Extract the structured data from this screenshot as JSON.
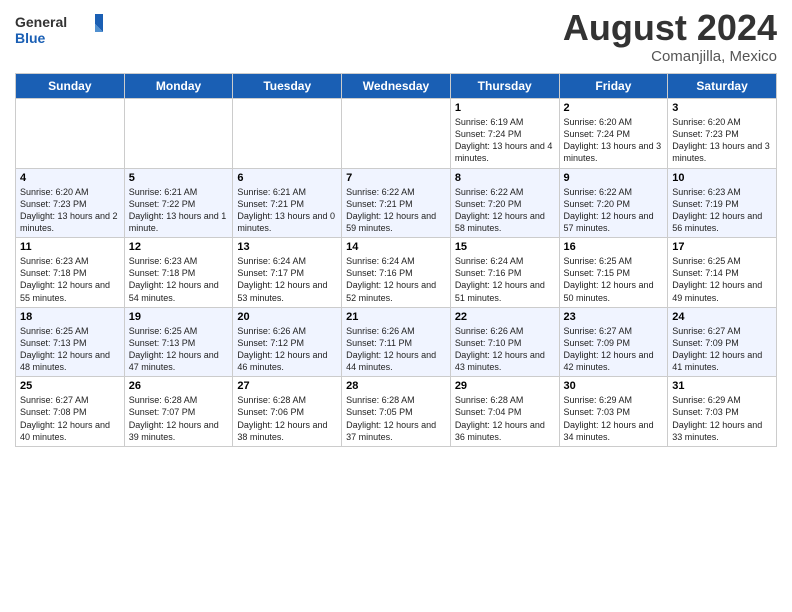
{
  "header": {
    "logo_general": "General",
    "logo_blue": "Blue",
    "month_title": "August 2024",
    "location": "Comanjilla, Mexico"
  },
  "days_of_week": [
    "Sunday",
    "Monday",
    "Tuesday",
    "Wednesday",
    "Thursday",
    "Friday",
    "Saturday"
  ],
  "weeks": [
    {
      "row_class": "row-white",
      "days": [
        {
          "num": "",
          "empty": true
        },
        {
          "num": "",
          "empty": true
        },
        {
          "num": "",
          "empty": true
        },
        {
          "num": "",
          "empty": true
        },
        {
          "num": "1",
          "sunrise": "6:19 AM",
          "sunset": "7:24 PM",
          "daylight": "13 hours and 4 minutes."
        },
        {
          "num": "2",
          "sunrise": "6:20 AM",
          "sunset": "7:24 PM",
          "daylight": "13 hours and 3 minutes."
        },
        {
          "num": "3",
          "sunrise": "6:20 AM",
          "sunset": "7:23 PM",
          "daylight": "13 hours and 3 minutes."
        }
      ]
    },
    {
      "row_class": "row-light",
      "days": [
        {
          "num": "4",
          "sunrise": "6:20 AM",
          "sunset": "7:23 PM",
          "daylight": "13 hours and 2 minutes."
        },
        {
          "num": "5",
          "sunrise": "6:21 AM",
          "sunset": "7:22 PM",
          "daylight": "13 hours and 1 minute."
        },
        {
          "num": "6",
          "sunrise": "6:21 AM",
          "sunset": "7:21 PM",
          "daylight": "13 hours and 0 minutes."
        },
        {
          "num": "7",
          "sunrise": "6:22 AM",
          "sunset": "7:21 PM",
          "daylight": "12 hours and 59 minutes."
        },
        {
          "num": "8",
          "sunrise": "6:22 AM",
          "sunset": "7:20 PM",
          "daylight": "12 hours and 58 minutes."
        },
        {
          "num": "9",
          "sunrise": "6:22 AM",
          "sunset": "7:20 PM",
          "daylight": "12 hours and 57 minutes."
        },
        {
          "num": "10",
          "sunrise": "6:23 AM",
          "sunset": "7:19 PM",
          "daylight": "12 hours and 56 minutes."
        }
      ]
    },
    {
      "row_class": "row-white",
      "days": [
        {
          "num": "11",
          "sunrise": "6:23 AM",
          "sunset": "7:18 PM",
          "daylight": "12 hours and 55 minutes."
        },
        {
          "num": "12",
          "sunrise": "6:23 AM",
          "sunset": "7:18 PM",
          "daylight": "12 hours and 54 minutes."
        },
        {
          "num": "13",
          "sunrise": "6:24 AM",
          "sunset": "7:17 PM",
          "daylight": "12 hours and 53 minutes."
        },
        {
          "num": "14",
          "sunrise": "6:24 AM",
          "sunset": "7:16 PM",
          "daylight": "12 hours and 52 minutes."
        },
        {
          "num": "15",
          "sunrise": "6:24 AM",
          "sunset": "7:16 PM",
          "daylight": "12 hours and 51 minutes."
        },
        {
          "num": "16",
          "sunrise": "6:25 AM",
          "sunset": "7:15 PM",
          "daylight": "12 hours and 50 minutes."
        },
        {
          "num": "17",
          "sunrise": "6:25 AM",
          "sunset": "7:14 PM",
          "daylight": "12 hours and 49 minutes."
        }
      ]
    },
    {
      "row_class": "row-light",
      "days": [
        {
          "num": "18",
          "sunrise": "6:25 AM",
          "sunset": "7:13 PM",
          "daylight": "12 hours and 48 minutes."
        },
        {
          "num": "19",
          "sunrise": "6:25 AM",
          "sunset": "7:13 PM",
          "daylight": "12 hours and 47 minutes."
        },
        {
          "num": "20",
          "sunrise": "6:26 AM",
          "sunset": "7:12 PM",
          "daylight": "12 hours and 46 minutes."
        },
        {
          "num": "21",
          "sunrise": "6:26 AM",
          "sunset": "7:11 PM",
          "daylight": "12 hours and 44 minutes."
        },
        {
          "num": "22",
          "sunrise": "6:26 AM",
          "sunset": "7:10 PM",
          "daylight": "12 hours and 43 minutes."
        },
        {
          "num": "23",
          "sunrise": "6:27 AM",
          "sunset": "7:09 PM",
          "daylight": "12 hours and 42 minutes."
        },
        {
          "num": "24",
          "sunrise": "6:27 AM",
          "sunset": "7:09 PM",
          "daylight": "12 hours and 41 minutes."
        }
      ]
    },
    {
      "row_class": "row-white",
      "days": [
        {
          "num": "25",
          "sunrise": "6:27 AM",
          "sunset": "7:08 PM",
          "daylight": "12 hours and 40 minutes."
        },
        {
          "num": "26",
          "sunrise": "6:28 AM",
          "sunset": "7:07 PM",
          "daylight": "12 hours and 39 minutes."
        },
        {
          "num": "27",
          "sunrise": "6:28 AM",
          "sunset": "7:06 PM",
          "daylight": "12 hours and 38 minutes."
        },
        {
          "num": "28",
          "sunrise": "6:28 AM",
          "sunset": "7:05 PM",
          "daylight": "12 hours and 37 minutes."
        },
        {
          "num": "29",
          "sunrise": "6:28 AM",
          "sunset": "7:04 PM",
          "daylight": "12 hours and 36 minutes."
        },
        {
          "num": "30",
          "sunrise": "6:29 AM",
          "sunset": "7:03 PM",
          "daylight": "12 hours and 34 minutes."
        },
        {
          "num": "31",
          "sunrise": "6:29 AM",
          "sunset": "7:03 PM",
          "daylight": "12 hours and 33 minutes."
        }
      ]
    }
  ],
  "labels": {
    "sunrise_prefix": "Sunrise: ",
    "sunset_prefix": "Sunset: ",
    "daylight_prefix": "Daylight: "
  }
}
